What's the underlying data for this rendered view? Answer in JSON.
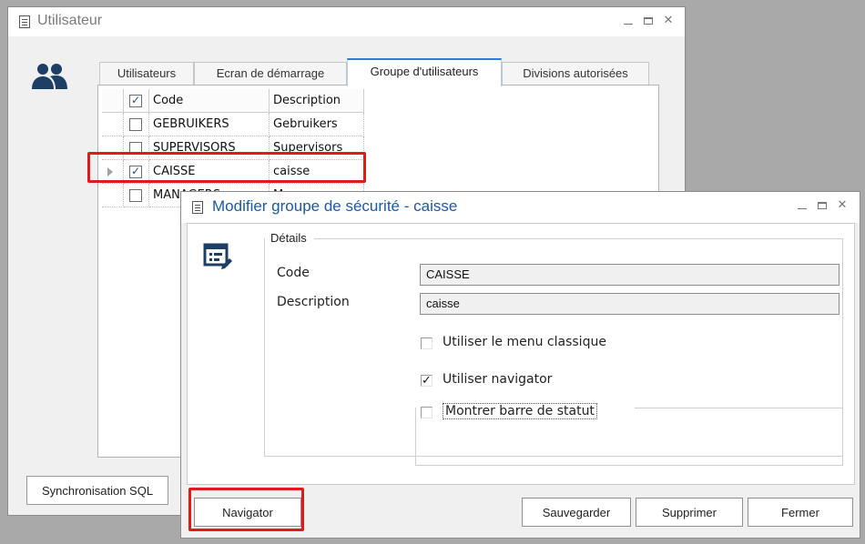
{
  "main_window": {
    "title": "Utilisateur",
    "tabs": [
      {
        "label": "Utilisateurs",
        "active": false
      },
      {
        "label": "Ecran de démarrage",
        "active": false
      },
      {
        "label": "Groupe d'utilisateurs",
        "active": true
      },
      {
        "label": "Divisions autorisées",
        "active": false
      }
    ],
    "grid": {
      "columns": [
        "Code",
        "Description"
      ],
      "header_checked": true,
      "rows": [
        {
          "code": "GEBRUIKERS",
          "description": "Gebruikers",
          "checked": false
        },
        {
          "code": "SUPERVISORS",
          "description": "Supervisors",
          "checked": false
        },
        {
          "code": "CAISSE",
          "description": "caisse",
          "checked": true
        },
        {
          "code": "MANAGERS",
          "description": "Managers",
          "checked": false
        }
      ]
    },
    "sync_button": "Synchronisation SQL"
  },
  "dialog": {
    "title": "Modifier groupe de sécurité - caisse",
    "group_title": "Détails",
    "code_label": "Code",
    "code_value": "CAISSE",
    "description_label": "Description",
    "description_value": "caisse",
    "checkboxes": [
      {
        "label": "Utiliser le menu classique",
        "checked": false
      },
      {
        "label": "Utiliser navigator",
        "checked": true
      },
      {
        "label": "Montrer barre de statut",
        "checked": false
      }
    ],
    "buttons": {
      "navigator": "Navigator",
      "save": "Sauvegarder",
      "delete": "Supprimer",
      "close": "Fermer"
    }
  },
  "colors": {
    "highlight": "#e0191c",
    "accent": "#2f7ad6",
    "dialog_title": "#1b5aa7"
  },
  "icons": {
    "window": "document-icon",
    "users": "users-icon",
    "form": "form-edit-icon"
  }
}
